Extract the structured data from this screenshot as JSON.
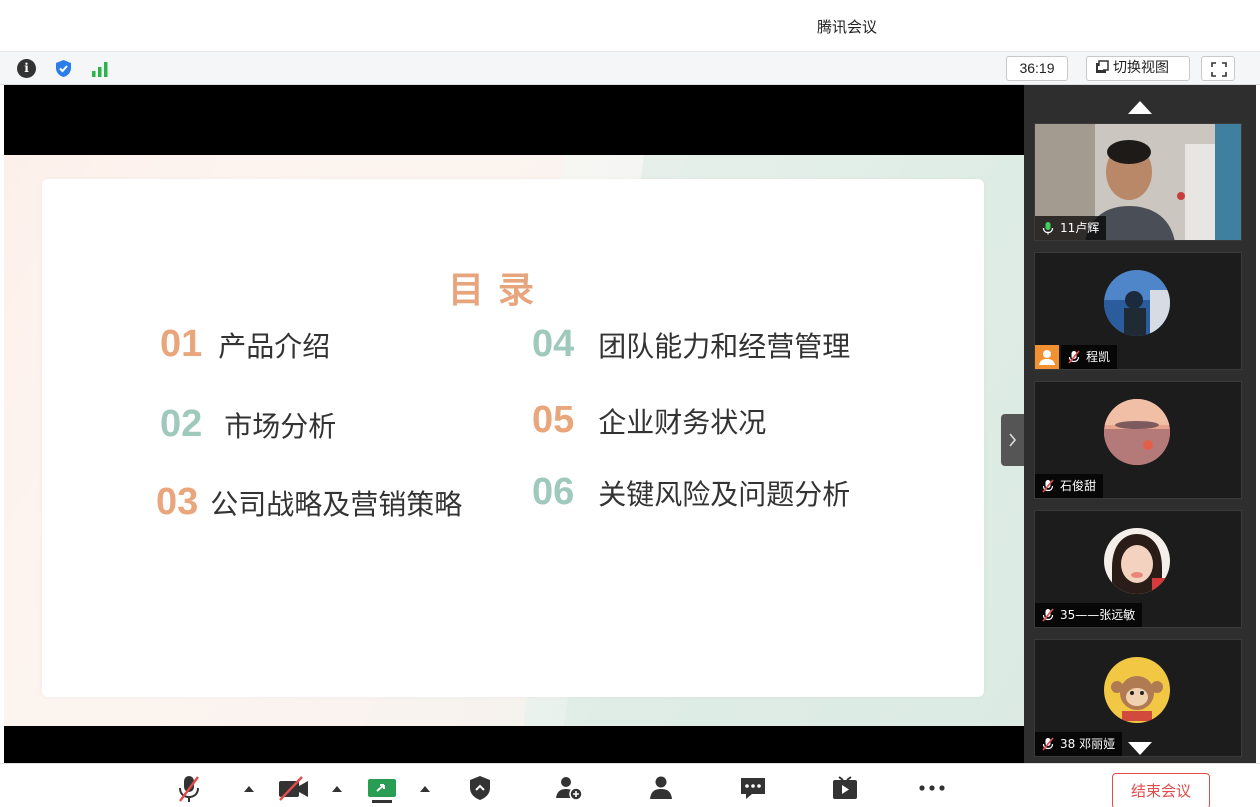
{
  "window": {
    "title": "腾讯会议"
  },
  "infobar": {
    "timer": "36:19",
    "switch_view_label": "切换视图",
    "icons": [
      "info-icon",
      "shield-icon",
      "signal-icon",
      "fullscreen-icon"
    ]
  },
  "slide": {
    "title": "目录",
    "items": [
      {
        "num": "01",
        "label": "产品介绍"
      },
      {
        "num": "02",
        "label": "市场分析"
      },
      {
        "num": "03",
        "label": "公司战略及营销策略"
      },
      {
        "num": "04",
        "label": "团队能力和经营管理"
      },
      {
        "num": "05",
        "label": "企业财务状况"
      },
      {
        "num": "06",
        "label": "关键风险及问题分析"
      }
    ],
    "colors": {
      "orange": "#e9a67c",
      "green": "#9fc9bc"
    }
  },
  "participants": [
    {
      "name": "11卢辉",
      "mic": "on",
      "video": true
    },
    {
      "name": "程凯",
      "mic": "muted",
      "video": false
    },
    {
      "name": "石俊甜",
      "mic": "muted",
      "video": false
    },
    {
      "name": "35——张远敏",
      "mic": "muted",
      "video": false
    },
    {
      "name": "38 邓丽娅",
      "mic": "muted",
      "video": false
    }
  ],
  "toolbar": {
    "end_meeting_label": "结束会议",
    "icons": [
      "mic-muted-icon",
      "video-off-icon",
      "share-screen-icon",
      "security-icon",
      "invite-icon",
      "members-icon",
      "chat-icon",
      "record-icon",
      "more-icon"
    ],
    "accent_color": "#e24c4c"
  }
}
